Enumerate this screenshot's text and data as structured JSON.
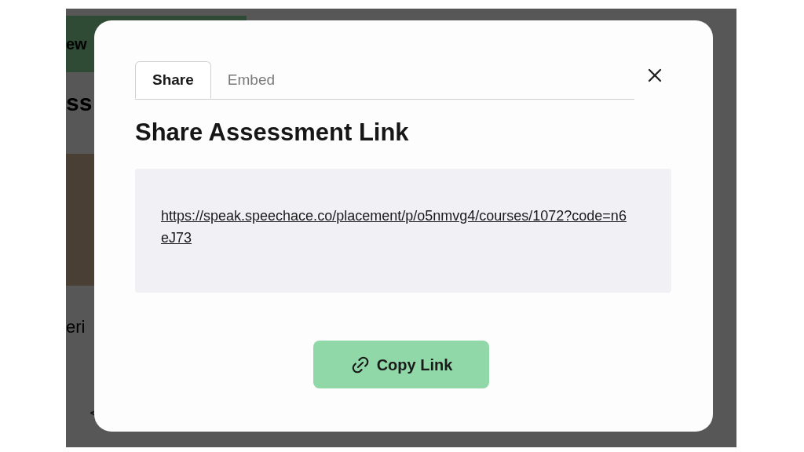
{
  "background": {
    "banner_text": "ew",
    "heading": "ss",
    "card_text": "eri"
  },
  "dialog": {
    "tabs": [
      {
        "label": "Share",
        "selected": true
      },
      {
        "label": "Embed",
        "selected": false
      }
    ],
    "title": "Share Assessment Link",
    "link": "https://speak.speechace.co/placement/p/o5nmvg4/courses/1072?code=n6eJ73",
    "copy_button": "Copy Link"
  }
}
